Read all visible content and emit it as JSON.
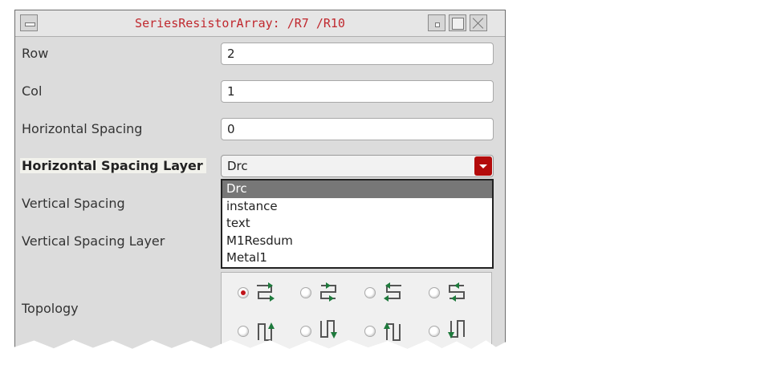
{
  "window": {
    "title": "SeriesResistorArray: /R7 /R10"
  },
  "form": {
    "row_label": "Row",
    "row_value": "2",
    "col_label": "Col",
    "col_value": "1",
    "hspacing_label": "Horizontal Spacing",
    "hspacing_value": "0",
    "hlayer_label": "Horizontal Spacing Layer",
    "hlayer_value": "Drc",
    "vspacing_label": "Vertical Spacing",
    "vlayer_label": "Vertical Spacing Layer",
    "topology_label": "Topology"
  },
  "dropdown": {
    "items": [
      "Drc",
      "instance",
      "text",
      "M1Resdum",
      "Metal1"
    ],
    "selected": "Drc"
  },
  "topology": {
    "options": [
      {
        "icon": "horizontal-serpentine-right-icon",
        "checked": true
      },
      {
        "icon": "horizontal-serpentine-right-alt-icon",
        "checked": false
      },
      {
        "icon": "horizontal-serpentine-left-icon",
        "checked": false
      },
      {
        "icon": "horizontal-serpentine-left-alt-icon",
        "checked": false
      },
      {
        "icon": "vertical-serpentine-up-icon",
        "checked": false
      },
      {
        "icon": "vertical-serpentine-down-icon",
        "checked": false
      },
      {
        "icon": "vertical-serpentine-up-alt-icon",
        "checked": false
      },
      {
        "icon": "vertical-serpentine-down-alt-icon",
        "checked": false
      }
    ]
  },
  "colors": {
    "title_text": "#c0282e",
    "accent_red": "#b30b0b",
    "selection_gray": "#777777",
    "arrow_green": "#1e7a3c"
  }
}
